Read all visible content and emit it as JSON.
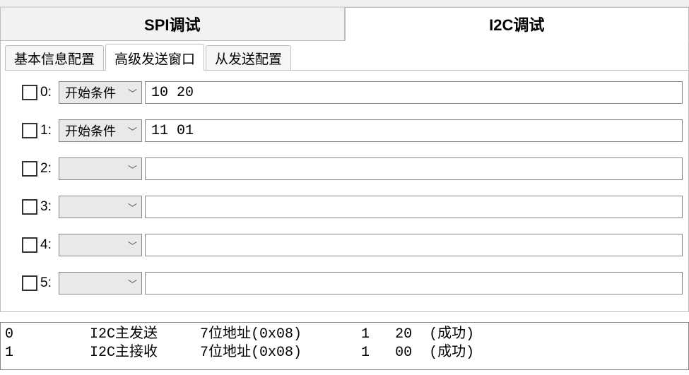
{
  "main_tabs": {
    "items": [
      {
        "label": "SPI调试",
        "active": false
      },
      {
        "label": "I2C调试",
        "active": true
      }
    ]
  },
  "sub_tabs": {
    "items": [
      {
        "label": "基本信息配置",
        "active": false
      },
      {
        "label": "高级发送窗口",
        "active": true
      },
      {
        "label": "从发送配置",
        "active": false
      }
    ]
  },
  "rows": [
    {
      "index_label": "0:",
      "condition": "开始条件",
      "data": "10 20"
    },
    {
      "index_label": "1:",
      "condition": "开始条件",
      "data": "11 01"
    },
    {
      "index_label": "2:",
      "condition": "",
      "data": ""
    },
    {
      "index_label": "3:",
      "condition": "",
      "data": ""
    },
    {
      "index_label": "4:",
      "condition": "",
      "data": ""
    },
    {
      "index_label": "5:",
      "condition": "",
      "data": ""
    }
  ],
  "log": {
    "lines": [
      "0         I2C主发送     7位地址(0x08)       1   20  (成功)",
      "1         I2C主接收     7位地址(0x08)       1   00  (成功)"
    ]
  }
}
